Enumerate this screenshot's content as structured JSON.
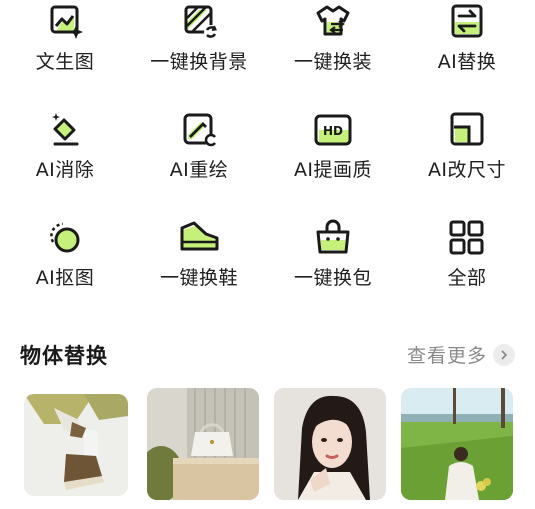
{
  "tools": [
    {
      "label": "文生图",
      "icon": "text-to-image-icon"
    },
    {
      "label": "一键换背景",
      "icon": "swap-background-icon"
    },
    {
      "label": "一键换装",
      "icon": "swap-outfit-icon"
    },
    {
      "label": "AI替换",
      "icon": "ai-replace-icon"
    },
    {
      "label": "AI消除",
      "icon": "eraser-icon"
    },
    {
      "label": "AI重绘",
      "icon": "redraw-icon"
    },
    {
      "label": "AI提画质",
      "icon": "hd-icon"
    },
    {
      "label": "AI改尺寸",
      "icon": "resize-icon"
    },
    {
      "label": "AI抠图",
      "icon": "cutout-icon"
    },
    {
      "label": "一键换鞋",
      "icon": "shoe-icon"
    },
    {
      "label": "一键换包",
      "icon": "bag-icon"
    },
    {
      "label": "全部",
      "icon": "grid-all-icon"
    }
  ],
  "section": {
    "title": "物体替换",
    "more_label": "查看更多"
  },
  "thumbnails": [
    {
      "subject": "sneakers-photo"
    },
    {
      "subject": "handbag-photo"
    },
    {
      "subject": "woman-portrait-photo"
    },
    {
      "subject": "garden-photo"
    }
  ],
  "colors": {
    "accent": "#c5f07a",
    "icon_stroke": "#1a1a1a",
    "muted": "#8a8a8a"
  }
}
